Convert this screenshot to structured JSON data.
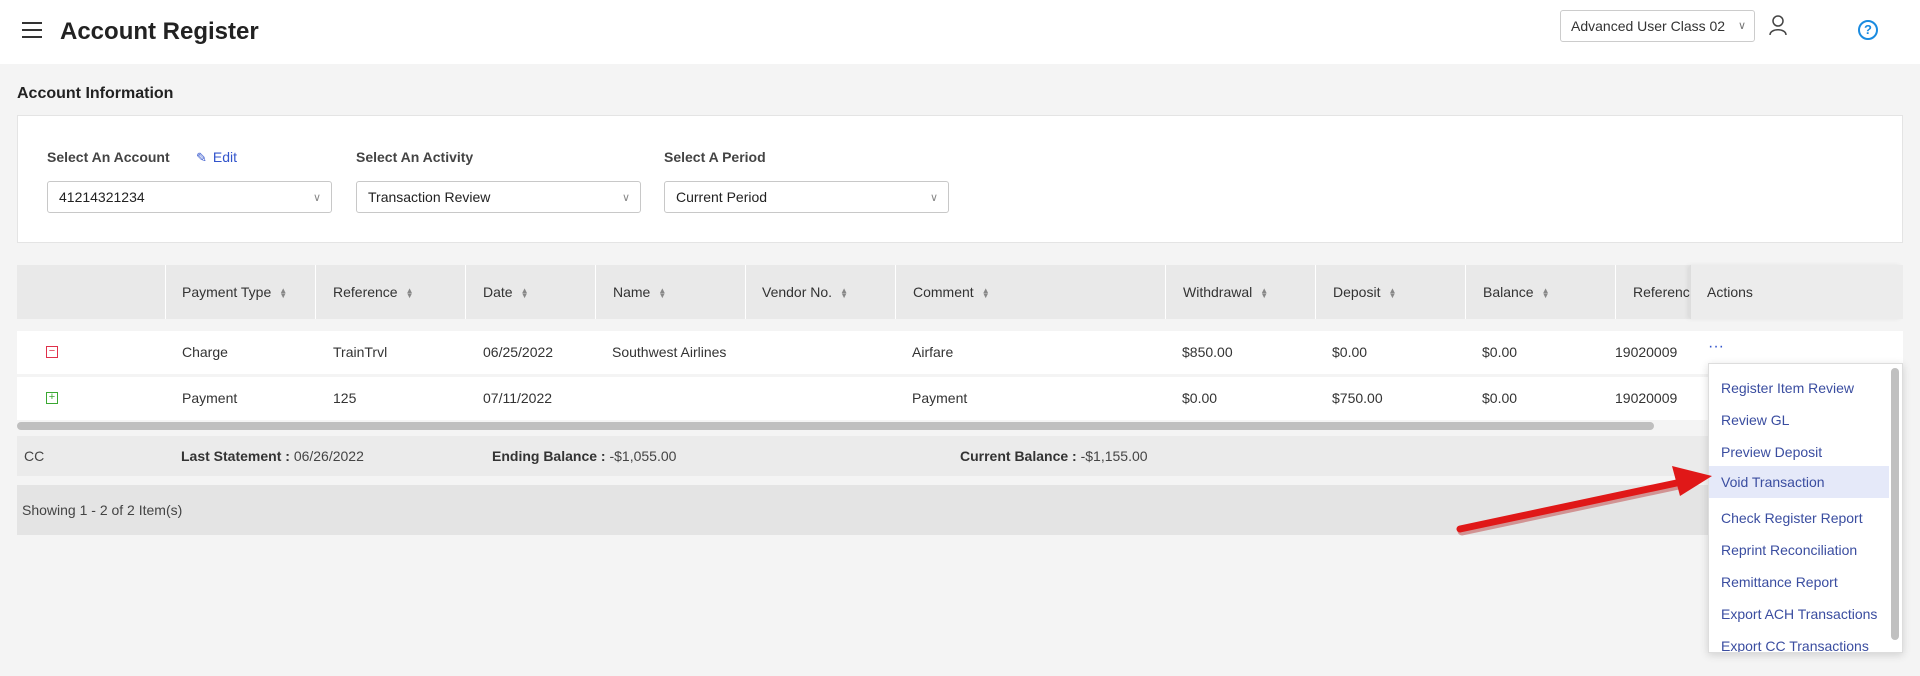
{
  "header": {
    "title": "Account Register",
    "class_select": "Advanced User Class 02",
    "help_glyph": "?"
  },
  "account_info": {
    "section_title": "Account Information",
    "account_label": "Select An Account",
    "edit_label": "Edit",
    "activity_label": "Select An Activity",
    "period_label": "Select A Period",
    "account_value": "41214321234",
    "activity_value": "Transaction Review",
    "period_value": "Current Period"
  },
  "table": {
    "columns": [
      "Payment Type",
      "Reference",
      "Date",
      "Name",
      "Vendor No.",
      "Comment",
      "Withdrawal",
      "Deposit",
      "Balance",
      "Reference"
    ],
    "actions_label": "Actions",
    "rows": [
      {
        "type": "Charge",
        "reference": "TrainTrvl",
        "date": "06/25/2022",
        "name": "Southwest Airlines",
        "vendor": "",
        "comment": "Airfare",
        "withdrawal": "$850.00",
        "deposit": "$0.00",
        "balance": "$0.00",
        "reference2": "19020009",
        "icon": "minus-icon"
      },
      {
        "type": "Payment",
        "reference": "125",
        "date": "07/11/2022",
        "name": "",
        "vendor": "",
        "comment": "Payment",
        "withdrawal": "$0.00",
        "deposit": "$750.00",
        "balance": "$0.00",
        "reference2": "19020009",
        "icon": "plus-icon"
      }
    ],
    "ellipsis": "···"
  },
  "summary": {
    "account_type": "CC",
    "last_statement_label": "Last Statement :",
    "last_statement_value": "06/26/2022",
    "ending_balance_label": "Ending Balance :",
    "ending_balance_value": "-$1,055.00",
    "current_balance_label": "Current Balance :",
    "current_balance_value": "-$1,155.00"
  },
  "pager": {
    "text": "Showing 1 - 2 of 2 Item(s)"
  },
  "menu": {
    "items": [
      "Register Item Review",
      "Review GL",
      "Preview Deposit",
      "Void Transaction",
      "Check Register Report",
      "Reprint Reconciliation",
      "Remittance Report",
      "Export ACH Transactions",
      "Export CC Transactions"
    ],
    "active_item": "Void Transaction"
  },
  "colors": {
    "link": "#3355cc",
    "minus": "#e0304a",
    "plus": "#3aa832",
    "arrow": "#e01818"
  }
}
